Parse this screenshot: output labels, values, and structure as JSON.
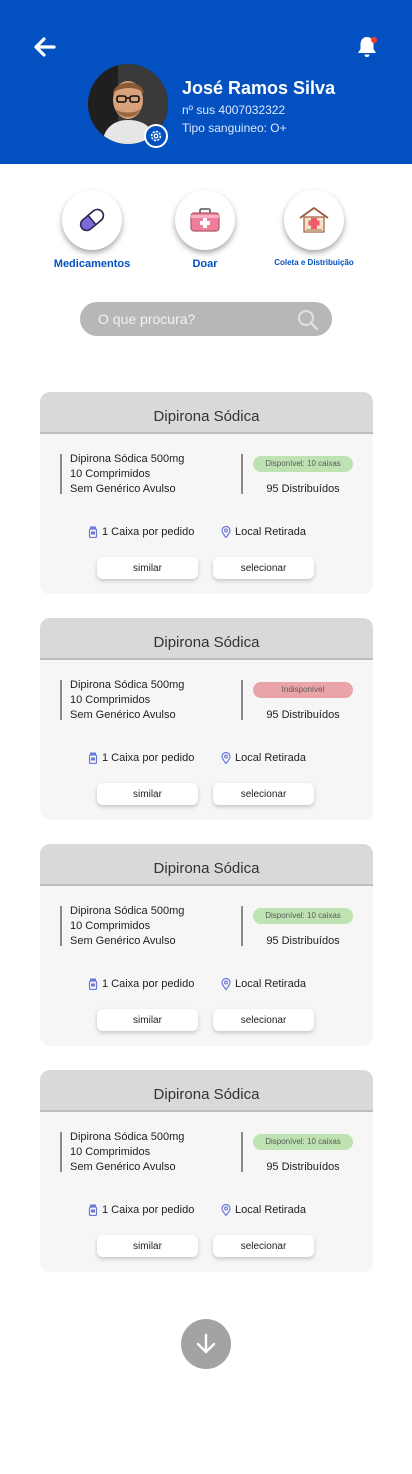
{
  "header": {
    "user_name": "José Ramos Silva",
    "sus_number": "nº sus 4007032322",
    "blood_type": "Tipo sanguineo: O+",
    "background_color": "#0351c1"
  },
  "icons": {
    "back": "arrow-left-icon",
    "notifications": "bell-icon",
    "settings": "gear-icon",
    "search": "search-icon",
    "scroll_down": "arrow-down-icon"
  },
  "menu": [
    {
      "label": "Medicamentos",
      "icon": "pill-icon"
    },
    {
      "label": "Doar",
      "icon": "medical-kit-icon"
    },
    {
      "label": "Coleta e Distribuição",
      "icon": "hospital-icon"
    }
  ],
  "search": {
    "placeholder": "O que procura?"
  },
  "colors": {
    "available": "#bfe2b3",
    "unavailable": "#e8a4a6",
    "accent": "#0351c1"
  },
  "cards": [
    {
      "title": "Dipirona Sódica",
      "lines": [
        "Dipirona Sódica 500mg",
        "10 Comprimidos",
        "Sem Genérico Avulso"
      ],
      "status": "Disponível: 10 caixas",
      "status_type": "available",
      "distributed": "95 Distribuídos",
      "limit": "1 Caixa por pedido",
      "location": "Local Retirada",
      "btn_similar": "similar",
      "btn_select": "selecionar"
    },
    {
      "title": "Dipirona Sódica",
      "lines": [
        "Dipirona Sódica 500mg",
        "10 Comprimidos",
        "Sem Genérico Avulso"
      ],
      "status": "Indisponível",
      "status_type": "unavailable",
      "distributed": "95 Distribuídos",
      "limit": "1 Caixa por pedido",
      "location": "Local Retirada",
      "btn_similar": "similar",
      "btn_select": "selecionar"
    },
    {
      "title": "Dipirona Sódica",
      "lines": [
        "Dipirona Sódica 500mg",
        "10 Comprimidos",
        "Sem Genérico Avulso"
      ],
      "status": "Disponível: 10 caixas",
      "status_type": "available",
      "distributed": "95 Distribuídos",
      "limit": "1 Caixa por pedido",
      "location": "Local Retirada",
      "btn_similar": "similar",
      "btn_select": "selecionar"
    },
    {
      "title": "Dipirona Sódica",
      "lines": [
        "Dipirona Sódica 500mg",
        "10 Comprimidos",
        "Sem Genérico Avulso"
      ],
      "status": "Disponível: 10 caixas",
      "status_type": "available",
      "distributed": "95 Distribuídos",
      "limit": "1 Caixa por pedido",
      "location": "Local Retirada",
      "btn_similar": "similar",
      "btn_select": "selecionar"
    }
  ]
}
